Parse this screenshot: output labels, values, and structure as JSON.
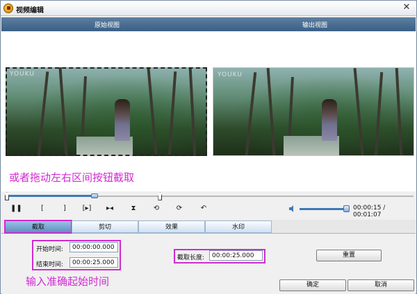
{
  "window": {
    "title": "视频编辑"
  },
  "views": {
    "original_label": "原始视图",
    "output_label": "输出视图",
    "watermark": "YOUKU"
  },
  "hints": {
    "top": "或者拖动左右区间按钮截取",
    "bottom": "输入准确起始时间"
  },
  "playback": {
    "time_display": "00:00:15 / 00:01:07",
    "progress_fraction": 0.22,
    "selection_start_fraction": 0.0,
    "selection_end_fraction": 0.38,
    "volume_fraction": 1.0
  },
  "controls": [
    "pause-icon",
    "mark-in-icon",
    "mark-out-icon",
    "play-selection-icon",
    "step-icon",
    "trim-icon",
    "rotate-left-icon",
    "rotate-right-icon",
    "undo-icon"
  ],
  "tabs": [
    {
      "label": "截取",
      "active": true
    },
    {
      "label": "剪切",
      "active": false
    },
    {
      "label": "效果",
      "active": false
    },
    {
      "label": "水印",
      "active": false
    }
  ],
  "crop": {
    "start_label": "开始时间:",
    "start_value": "00:00:00.000",
    "end_label": "结束时间:",
    "end_value": "00:00:25.000",
    "length_label": "截取长度:",
    "length_value": "00:00:25.000",
    "reset_label": "重置"
  },
  "footer": {
    "ok_label": "确定",
    "cancel_label": "取消"
  },
  "colors": {
    "accent": "#3d79b6",
    "annotation": "#d12ad1",
    "header": "#4a6e93"
  }
}
